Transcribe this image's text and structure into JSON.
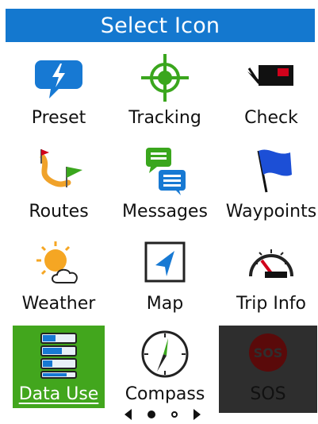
{
  "header": {
    "title": "Select Icon"
  },
  "tiles": [
    {
      "label": "Preset",
      "icon": "preset-icon"
    },
    {
      "label": "Tracking",
      "icon": "tracking-icon"
    },
    {
      "label": "Check",
      "icon": "check-icon"
    },
    {
      "label": "Routes",
      "icon": "routes-icon"
    },
    {
      "label": "Messages",
      "icon": "messages-icon"
    },
    {
      "label": "Waypoints",
      "icon": "waypoints-icon"
    },
    {
      "label": "Weather",
      "icon": "weather-icon"
    },
    {
      "label": "Map",
      "icon": "map-icon"
    },
    {
      "label": "Trip Info",
      "icon": "trip-info-icon"
    },
    {
      "label": "Data Use",
      "icon": "data-use-icon",
      "state": "selected"
    },
    {
      "label": "Compass",
      "icon": "compass-icon"
    },
    {
      "label": "SOS",
      "icon": "sos-icon",
      "state": "disabled"
    }
  ],
  "pager": {
    "pages": 2,
    "current": 1
  },
  "colors": {
    "header": "#1478cf",
    "selected": "#42a61d",
    "disabled": "#2e2e2e"
  }
}
